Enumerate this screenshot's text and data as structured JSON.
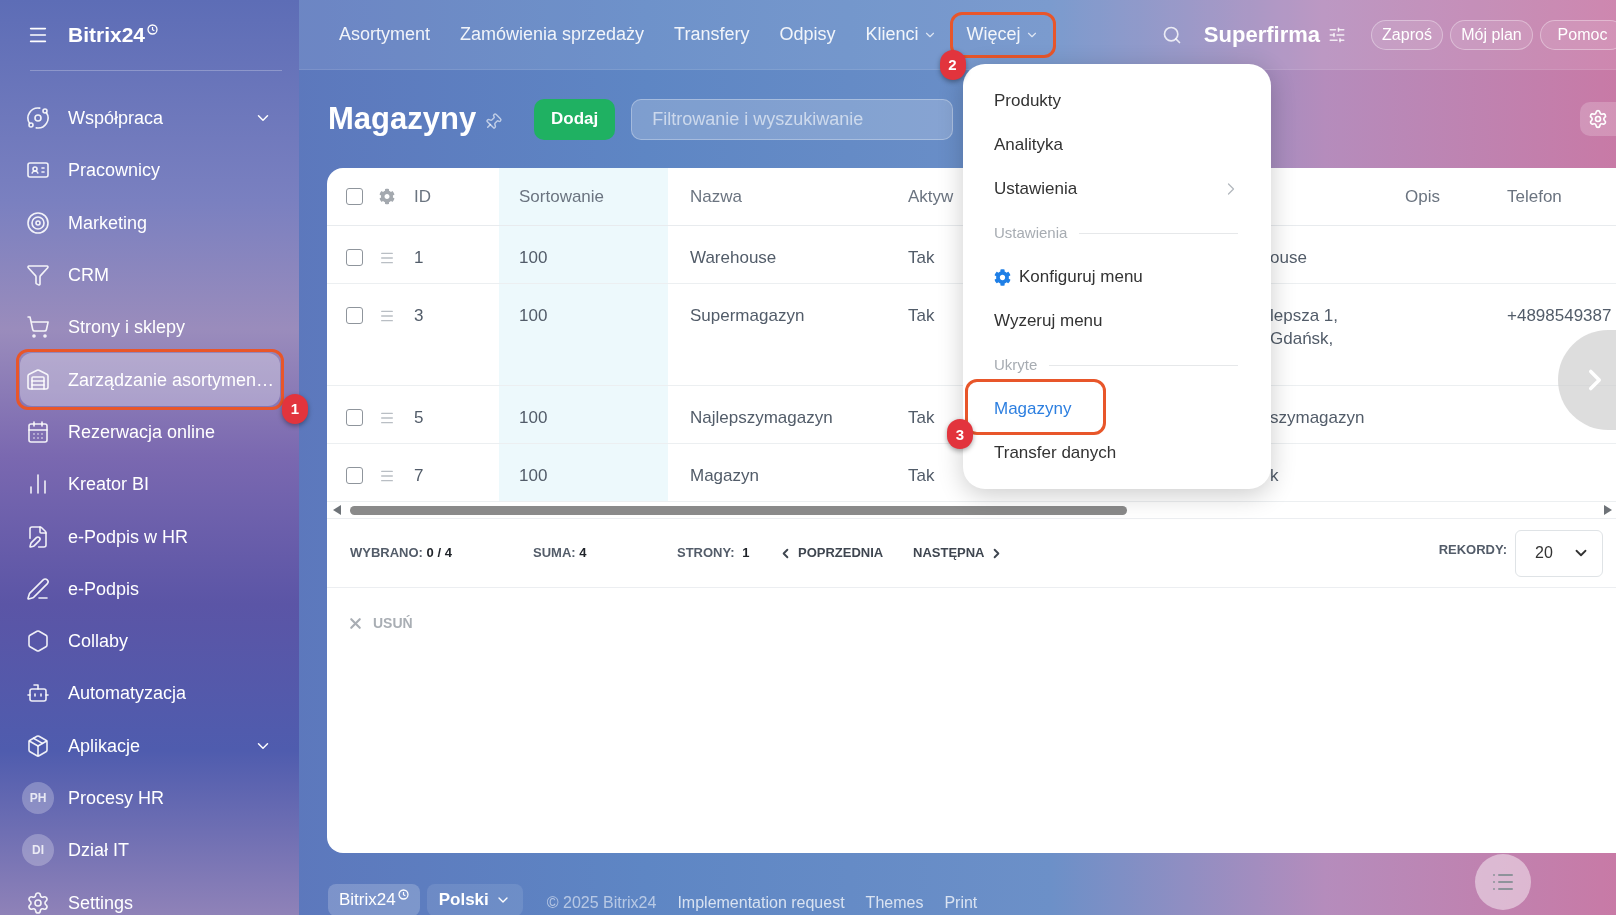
{
  "sidebar": {
    "logo": "Bitrix24",
    "items": [
      {
        "kind": "icon",
        "label": "Współpraca",
        "expandable": true,
        "selected": false
      },
      {
        "kind": "icon",
        "label": "Pracownicy",
        "expandable": false,
        "selected": false
      },
      {
        "kind": "icon",
        "label": "Marketing",
        "expandable": false,
        "selected": false
      },
      {
        "kind": "icon",
        "label": "CRM",
        "expandable": false,
        "selected": false
      },
      {
        "kind": "icon",
        "label": "Strony i sklepy",
        "expandable": false,
        "selected": false
      },
      {
        "kind": "icon",
        "label": "Zarządzanie asortymen…",
        "expandable": false,
        "selected": true,
        "callout": "1"
      },
      {
        "kind": "icon",
        "label": "Rezerwacja online",
        "expandable": false,
        "selected": false
      },
      {
        "kind": "icon",
        "label": "Kreator BI",
        "expandable": false,
        "selected": false
      },
      {
        "kind": "icon",
        "label": "e-Podpis w HR",
        "expandable": false,
        "selected": false
      },
      {
        "kind": "icon",
        "label": "e-Podpis",
        "expandable": false,
        "selected": false
      },
      {
        "kind": "icon",
        "label": "Collaby",
        "expandable": false,
        "selected": false
      },
      {
        "kind": "icon",
        "label": "Automatyzacja",
        "expandable": false,
        "selected": false
      },
      {
        "kind": "icon",
        "label": "Aplikacje",
        "expandable": true,
        "selected": false
      },
      {
        "kind": "avatar",
        "initials": "PH",
        "label": "Procesy HR",
        "expandable": false,
        "selected": false
      },
      {
        "kind": "avatar",
        "initials": "DI",
        "label": "Dział IT",
        "expandable": false,
        "selected": false
      },
      {
        "kind": "icon",
        "label": "Settings",
        "expandable": false,
        "selected": false
      }
    ]
  },
  "top_bar": {
    "nav": [
      {
        "label": "Asortyment",
        "caret": false
      },
      {
        "label": "Zamówienia sprzedaży",
        "caret": false
      },
      {
        "label": "Transfery",
        "caret": false
      },
      {
        "label": "Odpisy",
        "caret": false
      },
      {
        "label": "Klienci",
        "caret": true
      },
      {
        "label": "Więcej",
        "caret": true,
        "callout": "2"
      }
    ],
    "company": "Superfirma",
    "buttons": [
      "Zaproś",
      "Mój plan",
      "Pomoc"
    ]
  },
  "page": {
    "title": "Magazyny",
    "add_button": "Dodaj",
    "filter": {
      "placeholder": "Filtrowanie i wyszukiwanie"
    }
  },
  "table": {
    "select_all_checked": false,
    "columns": [
      {
        "label": "ID",
        "sorted": false
      },
      {
        "label": "Sortowanie",
        "sorted": true
      },
      {
        "label": "Nazwa",
        "sorted": false
      },
      {
        "label": "Aktyw",
        "sorted": false
      },
      {
        "label": "Opis",
        "sorted": false
      },
      {
        "label": "Telefon",
        "sorted": false
      }
    ],
    "rows": [
      {
        "checked": false,
        "id": "1",
        "sorting": "100",
        "name": "Warehouse",
        "active": "Tak",
        "column_5": [
          "ouse"
        ]
      },
      {
        "checked": false,
        "id": "3",
        "sorting": "100",
        "name": "Supermagazyn",
        "active": "Tak",
        "column_5": [
          "lepsza 1,",
          "Gdańsk,"
        ],
        "phone": "+4898549387"
      },
      {
        "checked": false,
        "id": "5",
        "sorting": "100",
        "name": "Najlepszymagazyn",
        "active": "Tak",
        "column_5": [
          "szymagazyn"
        ]
      },
      {
        "checked": false,
        "id": "7",
        "sorting": "100",
        "name": "Magazyn",
        "active": "Tak",
        "column_5": [
          "k"
        ]
      }
    ]
  },
  "pagination": {
    "selected_label": "WYBRANO:",
    "selected_value": "0 / 4",
    "total_label": "SUMA:",
    "total_value": "4",
    "pages_label": "STRONY:",
    "page": "1",
    "previous": "POPRZEDNIA",
    "next": "NASTĘPNA",
    "page_size_label": "REKORDY:",
    "page_size": "20"
  },
  "delete_action": {
    "label": "USUŃ",
    "disabled": true
  },
  "more_menu": {
    "items": [
      {
        "kind": "item",
        "label": "Produkty",
        "selected": false
      },
      {
        "kind": "item",
        "label": "Analityka",
        "selected": false
      },
      {
        "kind": "submenu",
        "label": "Ustawienia",
        "selected": false
      },
      {
        "kind": "section",
        "label": "Ustawienia"
      },
      {
        "kind": "setting",
        "label": "Konfiguruj menu",
        "selected": false
      },
      {
        "kind": "item",
        "label": "Wyzeruj menu",
        "selected": false
      },
      {
        "kind": "section",
        "label": "Ukryte"
      },
      {
        "kind": "item",
        "label": "Magazyny",
        "selected": true,
        "callout": "3"
      },
      {
        "kind": "item",
        "label": "Transfer danych",
        "selected": false
      }
    ]
  },
  "footer": {
    "brand": "Bitrix24",
    "language": "Polski",
    "copyright": "© 2025 Bitrix24",
    "links": [
      "Implementation request",
      "Themes",
      "Print"
    ]
  }
}
